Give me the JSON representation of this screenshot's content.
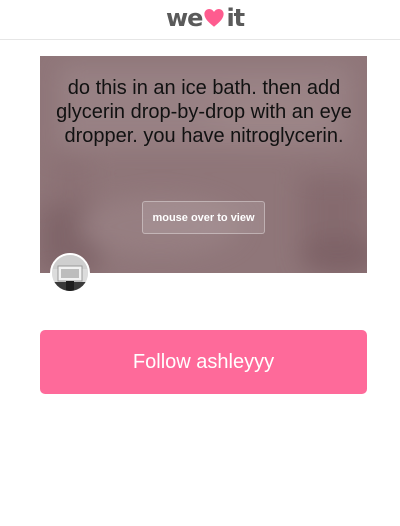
{
  "header": {
    "logo_left": "we",
    "logo_right": "it",
    "logo_icon": "heart-icon",
    "brand_color": "#fe5c8f"
  },
  "post": {
    "text": "do this in an ice bath. then add glycerin drop-by-drop with an eye dropper. you have nitroglycerin.",
    "reveal_label": "mouse over to view",
    "overlay_color": "#8e7477"
  },
  "user": {
    "avatar_icon": "user-avatar"
  },
  "follow": {
    "label": "Follow ashleyyy",
    "color": "#fe6a9a"
  }
}
